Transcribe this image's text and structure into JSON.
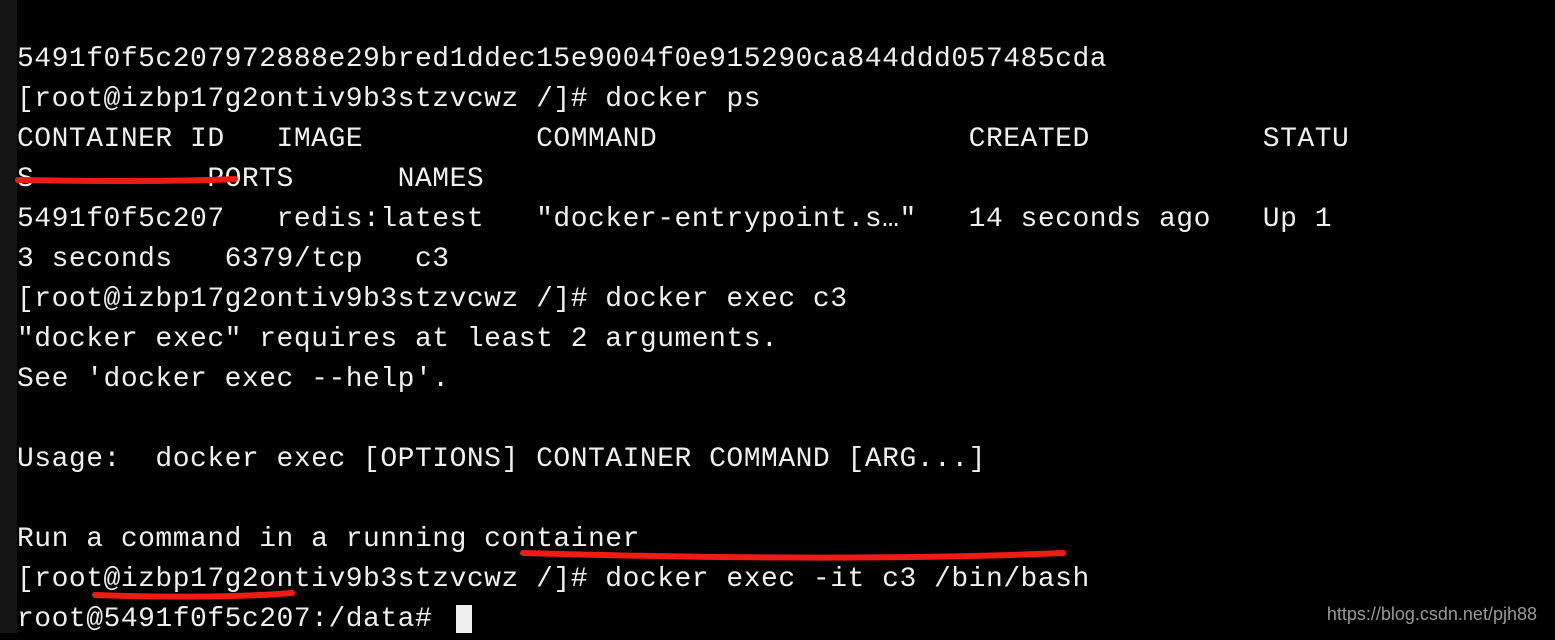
{
  "terminal": {
    "line0": "5491f0f5c207972888e29bred1ddec15e9004f0e915290ca844ddd057485cda",
    "line1": "[root@izbp17g2ontiv9b3stzvcwz /]# docker ps",
    "line2": "CONTAINER ID   IMAGE          COMMAND                  CREATED          STATU",
    "line3": "S          PORTS      NAMES",
    "line4": "5491f0f5c207   redis:latest   \"docker-entrypoint.s…\"   14 seconds ago   Up 1",
    "line5": "3 seconds   6379/tcp   c3",
    "line6": "[root@izbp17g2ontiv9b3stzvcwz /]# docker exec c3",
    "line7": "\"docker exec\" requires at least 2 arguments.",
    "line8": "See 'docker exec --help'.",
    "line9": "",
    "line10": "Usage:  docker exec [OPTIONS] CONTAINER COMMAND [ARG...]",
    "line11": "",
    "line12": "Run a command in a running container",
    "line13": "[root@izbp17g2ontiv9b3stzvcwz /]# docker exec -it c3 /bin/bash",
    "line14": "root@5491f0f5c207:/data# "
  },
  "watermark": "https://blog.csdn.net/pjh88",
  "annotation_color": "#ee1c15"
}
